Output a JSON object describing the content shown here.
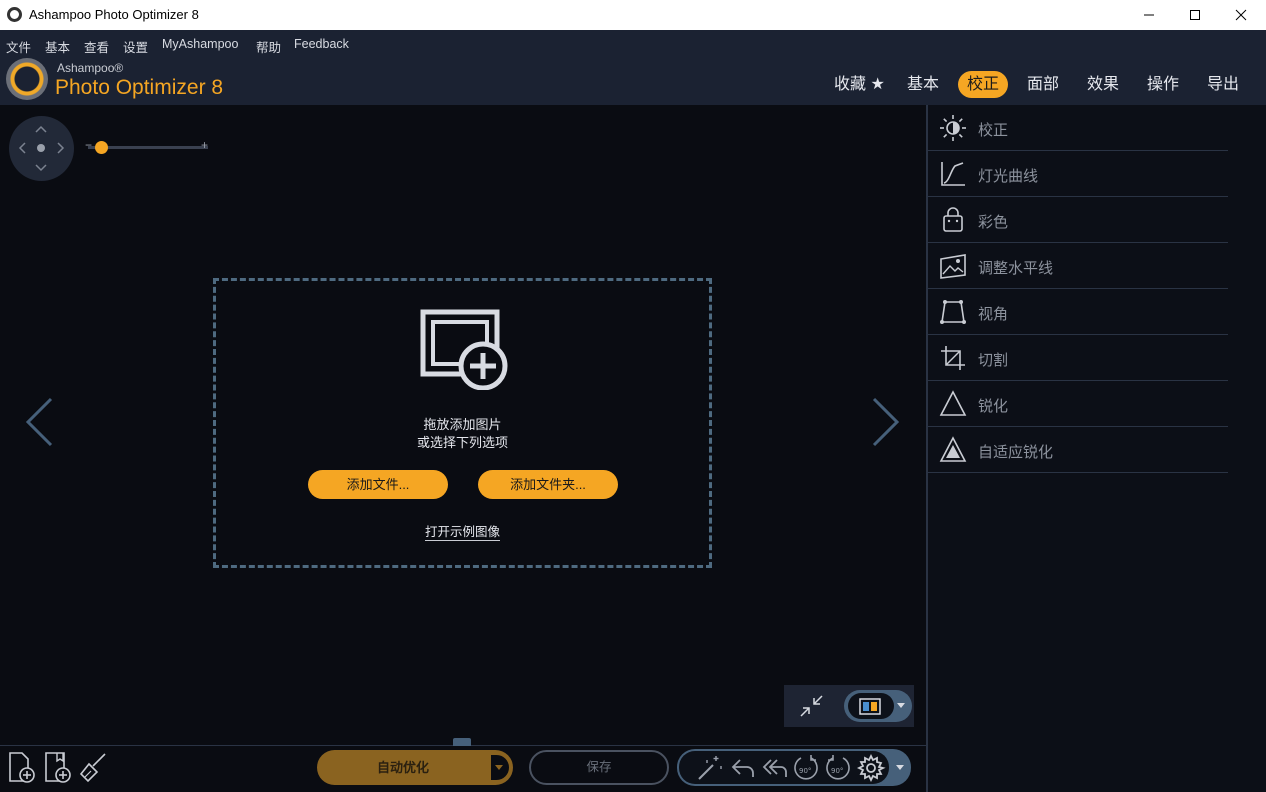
{
  "window": {
    "title": "Ashampoo Photo Optimizer 8"
  },
  "menu": {
    "items": [
      {
        "label": "文件"
      },
      {
        "label": "基本"
      },
      {
        "label": "查看"
      },
      {
        "label": "设置"
      },
      {
        "label": "MyAshampoo"
      },
      {
        "label": "帮助"
      },
      {
        "label": "Feedback"
      }
    ]
  },
  "brand": {
    "small": "Ashampoo®",
    "big": "Photo Optimizer 8"
  },
  "nav": {
    "tabs": [
      {
        "label": "收藏 ★",
        "active": false
      },
      {
        "label": "基本",
        "active": false
      },
      {
        "label": "校正",
        "active": true
      },
      {
        "label": "面部",
        "active": false
      },
      {
        "label": "效果",
        "active": false
      },
      {
        "label": "操作",
        "active": false
      },
      {
        "label": "导出",
        "active": false
      }
    ]
  },
  "zoom": {
    "minus": "−",
    "plus": "+",
    "level": 0.1
  },
  "dropzone": {
    "line1": "拖放添加图片",
    "line2": "或选择下列选项",
    "add_files": "添加文件...",
    "add_folder": "添加文件夹...",
    "open_sample": "打开示例图像"
  },
  "panel": {
    "items": [
      {
        "label": "校正",
        "icon": "brightness-icon"
      },
      {
        "label": "灯光曲线",
        "icon": "curve-icon"
      },
      {
        "label": "彩色",
        "icon": "color-bag-icon"
      },
      {
        "label": "调整水平线",
        "icon": "horizon-icon"
      },
      {
        "label": "视角",
        "icon": "perspective-icon"
      },
      {
        "label": "切割",
        "icon": "crop-icon"
      },
      {
        "label": "锐化",
        "icon": "sharpen-icon"
      },
      {
        "label": "自适应锐化",
        "icon": "adaptive-sharpen-icon"
      }
    ]
  },
  "bottom": {
    "auto_optimize": "自动优化",
    "save": "保存"
  },
  "colors": {
    "accent": "#f5a623",
    "header_bg": "#1b2232",
    "canvas_bg": "#0a0c12",
    "dashed_border": "#4e6a80",
    "panel_text": "#8c929d"
  }
}
